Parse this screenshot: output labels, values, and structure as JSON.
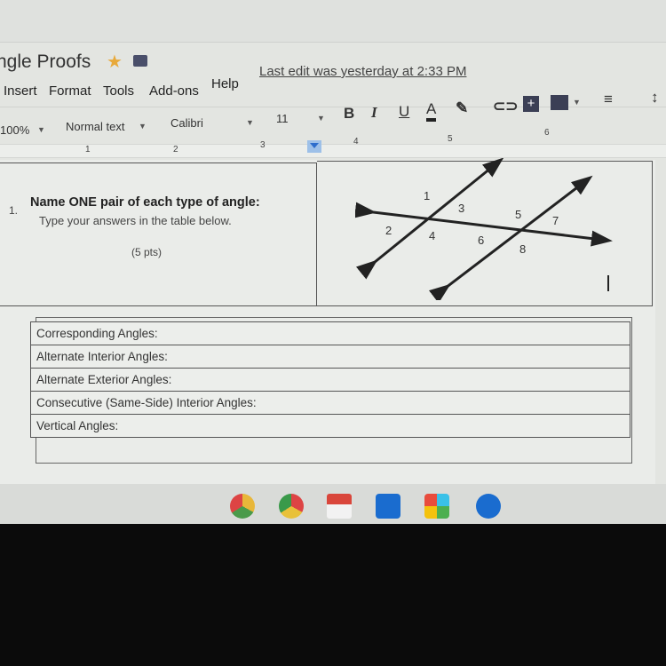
{
  "doc": {
    "title": "ngle Proofs",
    "last_edit": "Last edit was yesterday at 2:33 PM"
  },
  "menu": [
    "Insert",
    "Format",
    "Tools",
    "Add-ons",
    "Help"
  ],
  "toolbar": {
    "zoom": "100%",
    "style": "Normal text",
    "font": "Calibri",
    "size": "11",
    "bold": "B",
    "italic": "I",
    "underline": "U",
    "text_color": "A"
  },
  "ruler": [
    "1",
    "2",
    "3",
    "4",
    "5",
    "6"
  ],
  "question": {
    "number": "1.",
    "title": "Name ONE pair of each type of angle:",
    "subtitle": "Type your answers in the table below.",
    "points": "(5 pts)"
  },
  "diagram": {
    "angle_labels": [
      "1",
      "2",
      "3",
      "4",
      "5",
      "6",
      "7",
      "8"
    ]
  },
  "answers": [
    "Corresponding Angles:",
    "Alternate Interior Angles:",
    "Alternate Exterior Angles:",
    "Consecutive (Same-Side) Interior Angles:",
    "Vertical Angles:"
  ],
  "shelf": {
    "apps": [
      "chrome-canary",
      "chrome",
      "gmail",
      "camera",
      "play-store",
      "files"
    ]
  }
}
